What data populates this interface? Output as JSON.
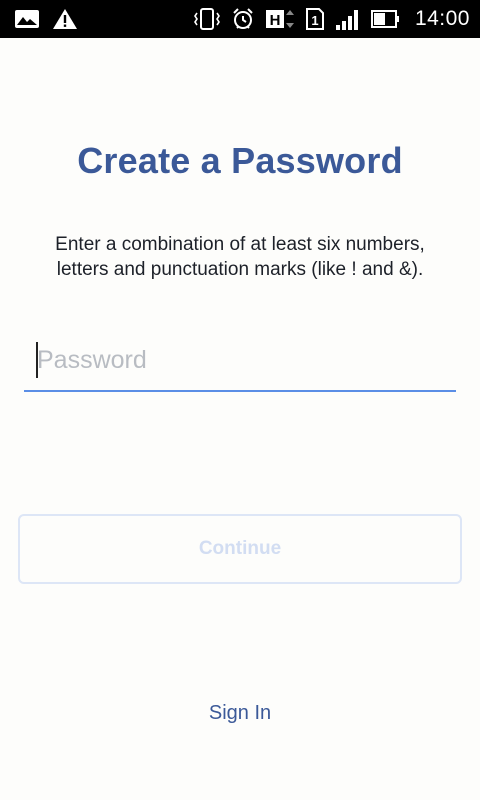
{
  "status_bar": {
    "time": "14:00",
    "network_type": "H",
    "sim_slot": "1",
    "left_icons": [
      "image-icon",
      "warning-icon"
    ],
    "right_icons": [
      "vibrate-icon",
      "alarm-icon",
      "network-h-icon",
      "sim-icon",
      "signal-icon",
      "battery-icon"
    ]
  },
  "screen": {
    "title": "Create a Password",
    "instructions": "Enter a combination of at least six numbers, letters and punctuation marks (like ! and &).",
    "password_field": {
      "placeholder": "Password",
      "value": ""
    },
    "continue_label": "Continue",
    "continue_enabled": false,
    "sign_in_label": "Sign In"
  },
  "colors": {
    "brand": "#3b5998",
    "field_underline": "#5b8ee6",
    "disabled_text": "#d2ddf2",
    "background": "#fdfdfb"
  }
}
